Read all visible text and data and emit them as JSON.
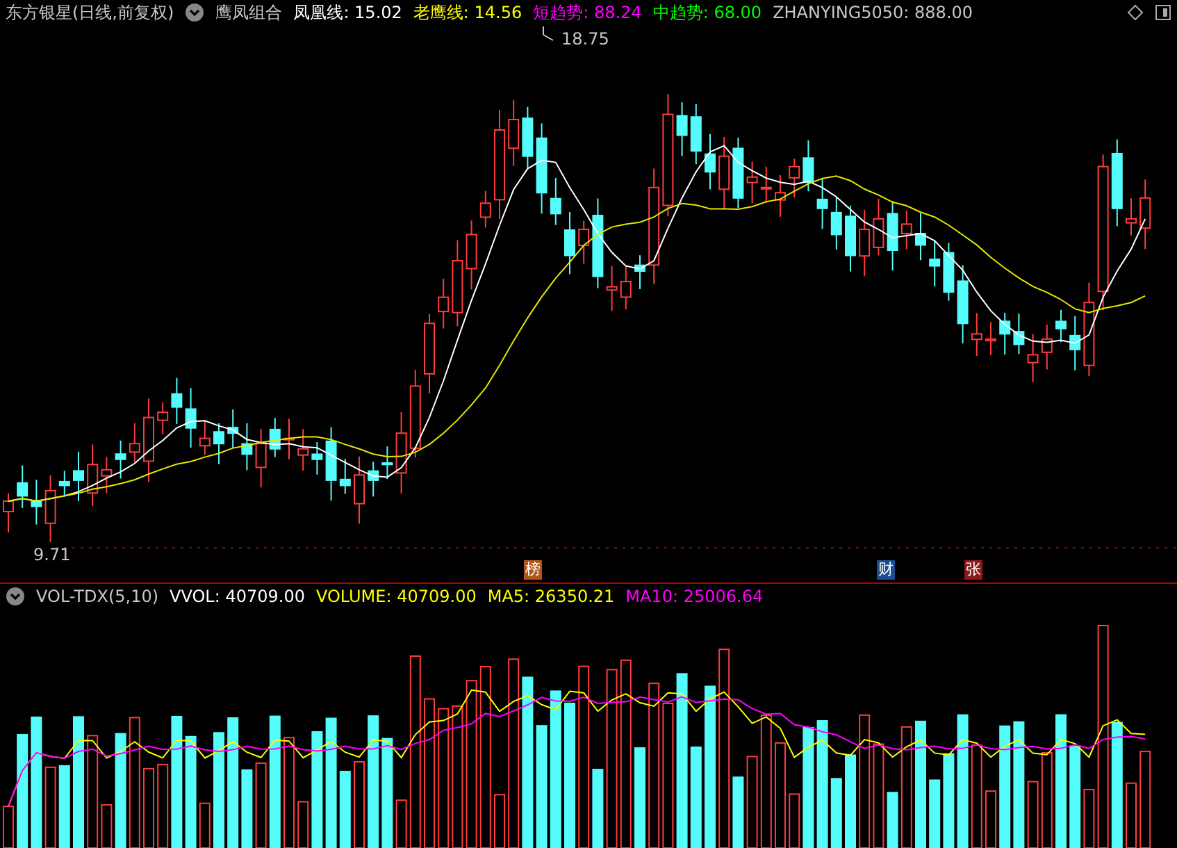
{
  "header": {
    "security": "东方银星(日线,前复权)",
    "indicator": "鹰凤组合"
  },
  "legend": [
    {
      "label": "凤凰线: 15.02",
      "color": "#ffffff"
    },
    {
      "label": "老鹰线: 14.56",
      "color": "#ffff00"
    },
    {
      "label": "短趋势: 88.24",
      "color": "#ff00ff"
    },
    {
      "label": "中趋势: 68.00",
      "color": "#00ff00"
    },
    {
      "label": "ZHANYING5050: 888.00",
      "color": "#c8c8c8"
    }
  ],
  "price_panel": {
    "high_label": "18.75",
    "low_label": "9.71",
    "markers": [
      {
        "text": "榜",
        "color": "#b0561a"
      },
      {
        "text": "财",
        "color": "#1d4e94"
      },
      {
        "text": "张",
        "color": "#8c1c1c"
      }
    ]
  },
  "volume_panel": {
    "name": "VOL-TDX(5,10)",
    "legend": [
      {
        "label": "VVOL: 40709.00",
        "color": "#ffffff"
      },
      {
        "label": "VOLUME: 40709.00",
        "color": "#ffff00"
      },
      {
        "label": "MA5: 26350.21",
        "color": "#ffff00"
      },
      {
        "label": "MA10: 25006.64",
        "color": "#ff00ff"
      }
    ]
  }
}
